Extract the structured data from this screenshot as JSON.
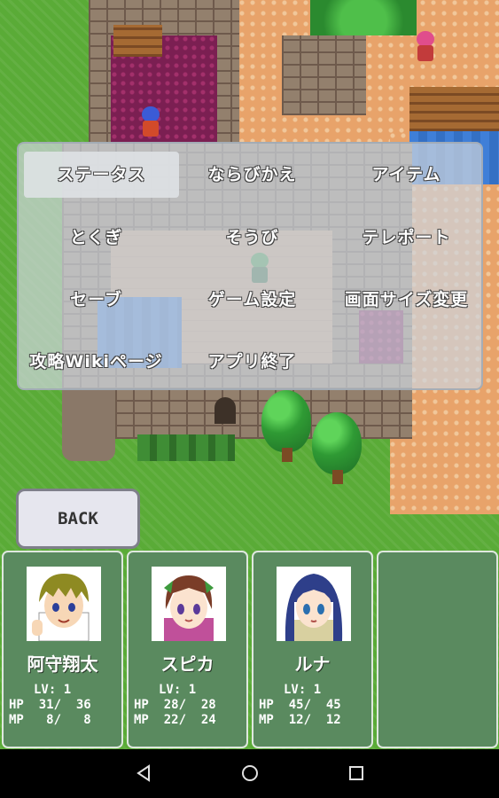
{
  "menu": {
    "items": [
      {
        "label": "ステータス",
        "selected": true
      },
      {
        "label": "ならびかえ",
        "selected": false
      },
      {
        "label": "アイテム",
        "selected": false
      },
      {
        "label": "とくぎ",
        "selected": false
      },
      {
        "label": "そうび",
        "selected": false
      },
      {
        "label": "テレポート",
        "selected": false
      },
      {
        "label": "セーブ",
        "selected": false
      },
      {
        "label": "ゲーム設定",
        "selected": false
      },
      {
        "label": "画面サイズ変更",
        "selected": false
      },
      {
        "label": "攻略Wikiページ",
        "selected": false
      },
      {
        "label": "アプリ終了",
        "selected": false
      }
    ]
  },
  "back_button": {
    "label": "BACK"
  },
  "party": [
    {
      "name": "阿守翔太",
      "lv": "LV: 1",
      "hp": "HP  31/  36",
      "mp": "MP   8/   8"
    },
    {
      "name": "スピカ",
      "lv": "LV: 1",
      "hp": "HP  28/  28",
      "mp": "MP  22/  24"
    },
    {
      "name": "ルナ",
      "lv": "LV: 1",
      "hp": "HP  45/  45",
      "mp": "MP  12/  12"
    }
  ],
  "navbar": {
    "back_icon": "triangle-back-icon",
    "home_icon": "circle-home-icon",
    "recents_icon": "square-recents-icon"
  },
  "colors": {
    "card_bg": "#5a8a5f",
    "menu_panel": "#cdd4dc",
    "grass": "#5aab37",
    "sand": "#e8a36a"
  }
}
